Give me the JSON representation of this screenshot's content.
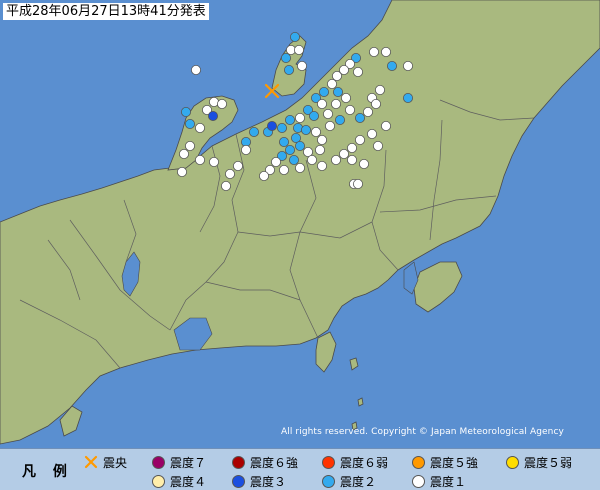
{
  "title": "平成28年06月27日13時41分発表",
  "credit": "All rights reserved. Copyright © Japan Meteorological Agency",
  "legend": {
    "label": "凡 例",
    "items": [
      {
        "label": "震央",
        "symbol": "epicenter-x",
        "color": "#ff9900"
      },
      {
        "label": "震度７",
        "symbol": "circle",
        "color": "#990066"
      },
      {
        "label": "震度６強",
        "symbol": "circle",
        "color": "#aa0000"
      },
      {
        "label": "震度６弱",
        "symbol": "circle",
        "color": "#ff3300"
      },
      {
        "label": "震度５強",
        "symbol": "circle",
        "color": "#ff9900"
      },
      {
        "label": "震度５弱",
        "symbol": "circle",
        "color": "#ffdd00"
      },
      {
        "label": "震度４",
        "symbol": "circle",
        "color": "#ffeeaa"
      },
      {
        "label": "震度３",
        "symbol": "circle",
        "color": "#1a4fe0"
      },
      {
        "label": "震度２",
        "symbol": "circle",
        "color": "#33aaee"
      },
      {
        "label": "震度１",
        "symbol": "circle",
        "color": "#ffffff"
      }
    ]
  },
  "colors": {
    "sea": "#5a8fd0",
    "land": "#a9b97f",
    "border": "#555555",
    "legend_bg": "#b4cce6",
    "epicenter": "#ff9900",
    "intensity_3": "#1a4fe0",
    "intensity_2": "#33aaee",
    "intensity_1": "#ffffff"
  }
}
